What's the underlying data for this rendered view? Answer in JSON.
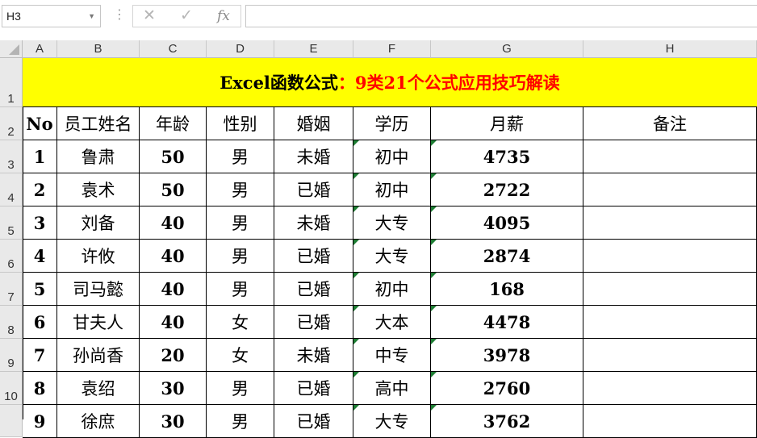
{
  "name_box": {
    "value": "H3"
  },
  "formula_bar": {
    "cancel_icon": "✕",
    "enter_icon": "✓",
    "fx_icon": "fx",
    "formula": ""
  },
  "columns": [
    "A",
    "B",
    "C",
    "D",
    "E",
    "F",
    "G",
    "H"
  ],
  "rows": [
    "1",
    "2",
    "3",
    "4",
    "5",
    "6",
    "7",
    "8",
    "9",
    "10"
  ],
  "title": {
    "part1": "Excel函数公式",
    "part2": "：9类21个公式应用技巧解读"
  },
  "headers": [
    "No",
    "员工姓名",
    "年龄",
    "性别",
    "婚姻",
    "学历",
    "月薪",
    "备注"
  ],
  "data_rows": [
    [
      "1",
      "鲁肃",
      "50",
      "男",
      "未婚",
      "初中",
      "4735",
      ""
    ],
    [
      "2",
      "袁术",
      "50",
      "男",
      "已婚",
      "初中",
      "2722",
      ""
    ],
    [
      "3",
      "刘备",
      "40",
      "男",
      "未婚",
      "大专",
      "4095",
      ""
    ],
    [
      "4",
      "许攸",
      "40",
      "男",
      "已婚",
      "大专",
      "2874",
      ""
    ],
    [
      "5",
      "司马懿",
      "40",
      "男",
      "已婚",
      "初中",
      "168",
      ""
    ],
    [
      "6",
      "甘夫人",
      "40",
      "女",
      "已婚",
      "大本",
      "4478",
      ""
    ],
    [
      "7",
      "孙尚香",
      "20",
      "女",
      "未婚",
      "中专",
      "3978",
      ""
    ],
    [
      "8",
      "袁绍",
      "30",
      "男",
      "已婚",
      "高中",
      "2760",
      ""
    ],
    [
      "9",
      "徐庶",
      "30",
      "男",
      "已婚",
      "大专",
      "3762",
      ""
    ]
  ],
  "colors": {
    "title_bg": "#ffff00",
    "title_accent": "#ff0000",
    "error_marker": "#1e7e34"
  }
}
